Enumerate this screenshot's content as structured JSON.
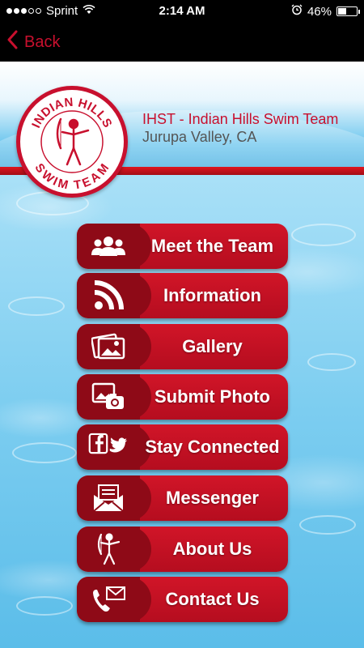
{
  "status_bar": {
    "carrier": "Sprint",
    "time": "2:14 AM",
    "battery_percent": "46%",
    "battery_level": 0.46,
    "signal_bars": 3,
    "signal_total": 5
  },
  "nav": {
    "back_label": "Back"
  },
  "header": {
    "team_title": "IHST - Indian Hills Swim Team",
    "location": "Jurupa Valley, CA",
    "logo_top_text": "INDIAN HILLS",
    "logo_bottom_text": "SWIM TEAM"
  },
  "menu": [
    {
      "label": "Meet the Team",
      "icon": "group-icon"
    },
    {
      "label": "Information",
      "icon": "rss-icon"
    },
    {
      "label": "Gallery",
      "icon": "photos-icon"
    },
    {
      "label": "Submit Photo",
      "icon": "camera-photo-icon"
    },
    {
      "label": "Stay Connected",
      "icon": "social-icon"
    },
    {
      "label": "Messenger",
      "icon": "envelope-icon"
    },
    {
      "label": "About Us",
      "icon": "archer-icon"
    },
    {
      "label": "Contact Us",
      "icon": "phone-mail-icon"
    }
  ],
  "colors": {
    "accent_red": "#c8102e",
    "button_red": "#d11528",
    "button_dark": "#8e0a17",
    "pool_blue": "#7ccdf0"
  }
}
